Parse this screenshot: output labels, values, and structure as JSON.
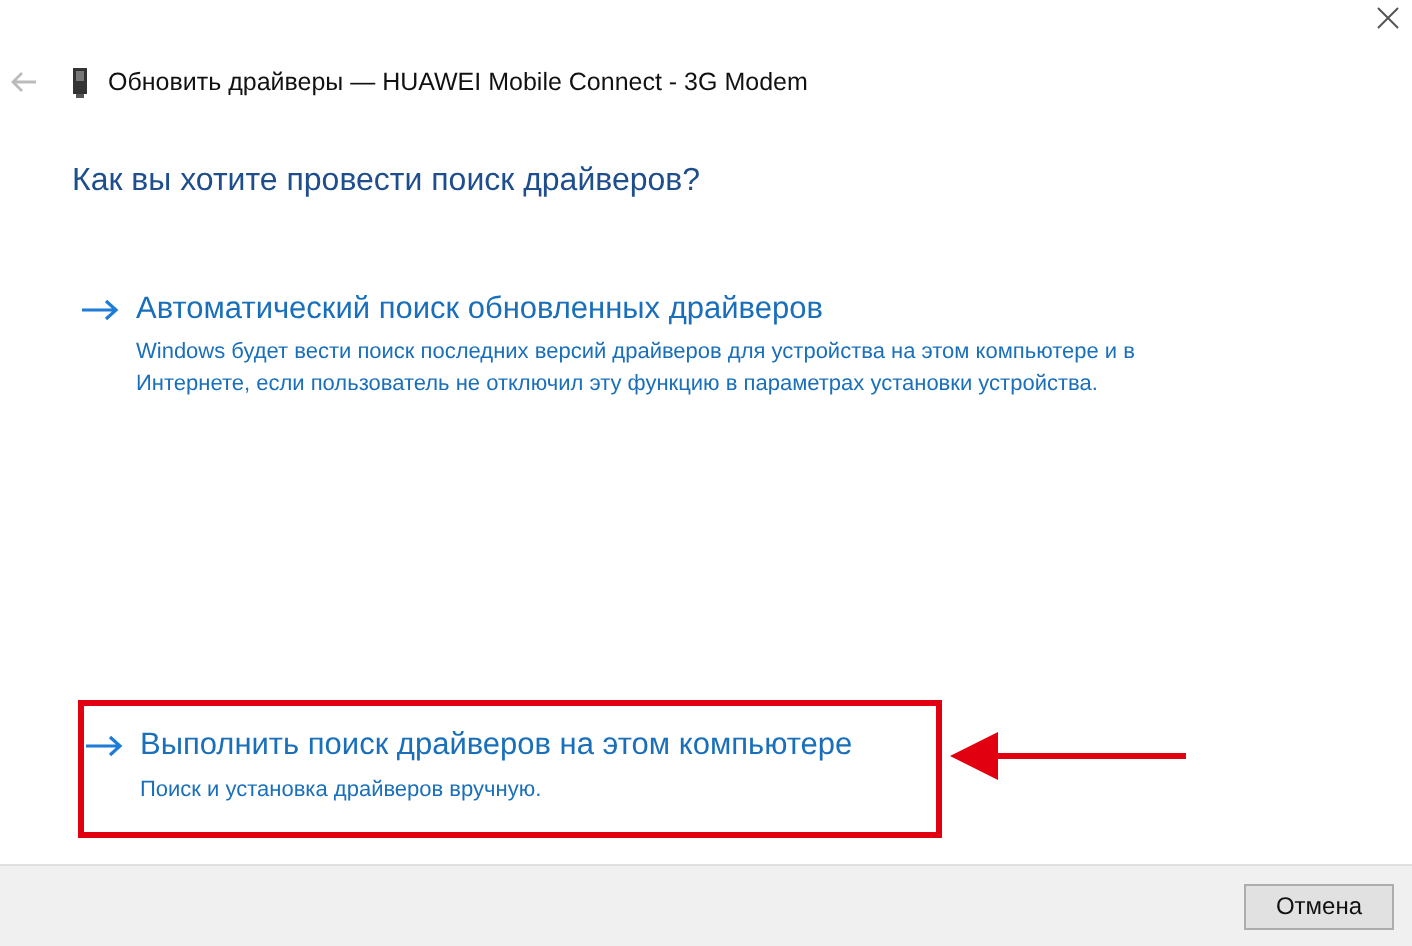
{
  "window": {
    "title": "Обновить драйверы — HUAWEI Mobile Connect - 3G Modem"
  },
  "heading": "Как вы хотите провести поиск драйверов?",
  "options": [
    {
      "title": "Автоматический поиск обновленных драйверов",
      "description": "Windows будет вести поиск последних версий драйверов для устройства на этом компьютере и в Интернете, если пользователь не отключил эту функцию в параметрах установки устройства.",
      "highlighted": false
    },
    {
      "title": "Выполнить поиск драйверов на этом компьютере",
      "description": "Поиск и установка драйверов вручную.",
      "highlighted": true
    }
  ],
  "buttons": [
    "Отмена"
  ]
}
